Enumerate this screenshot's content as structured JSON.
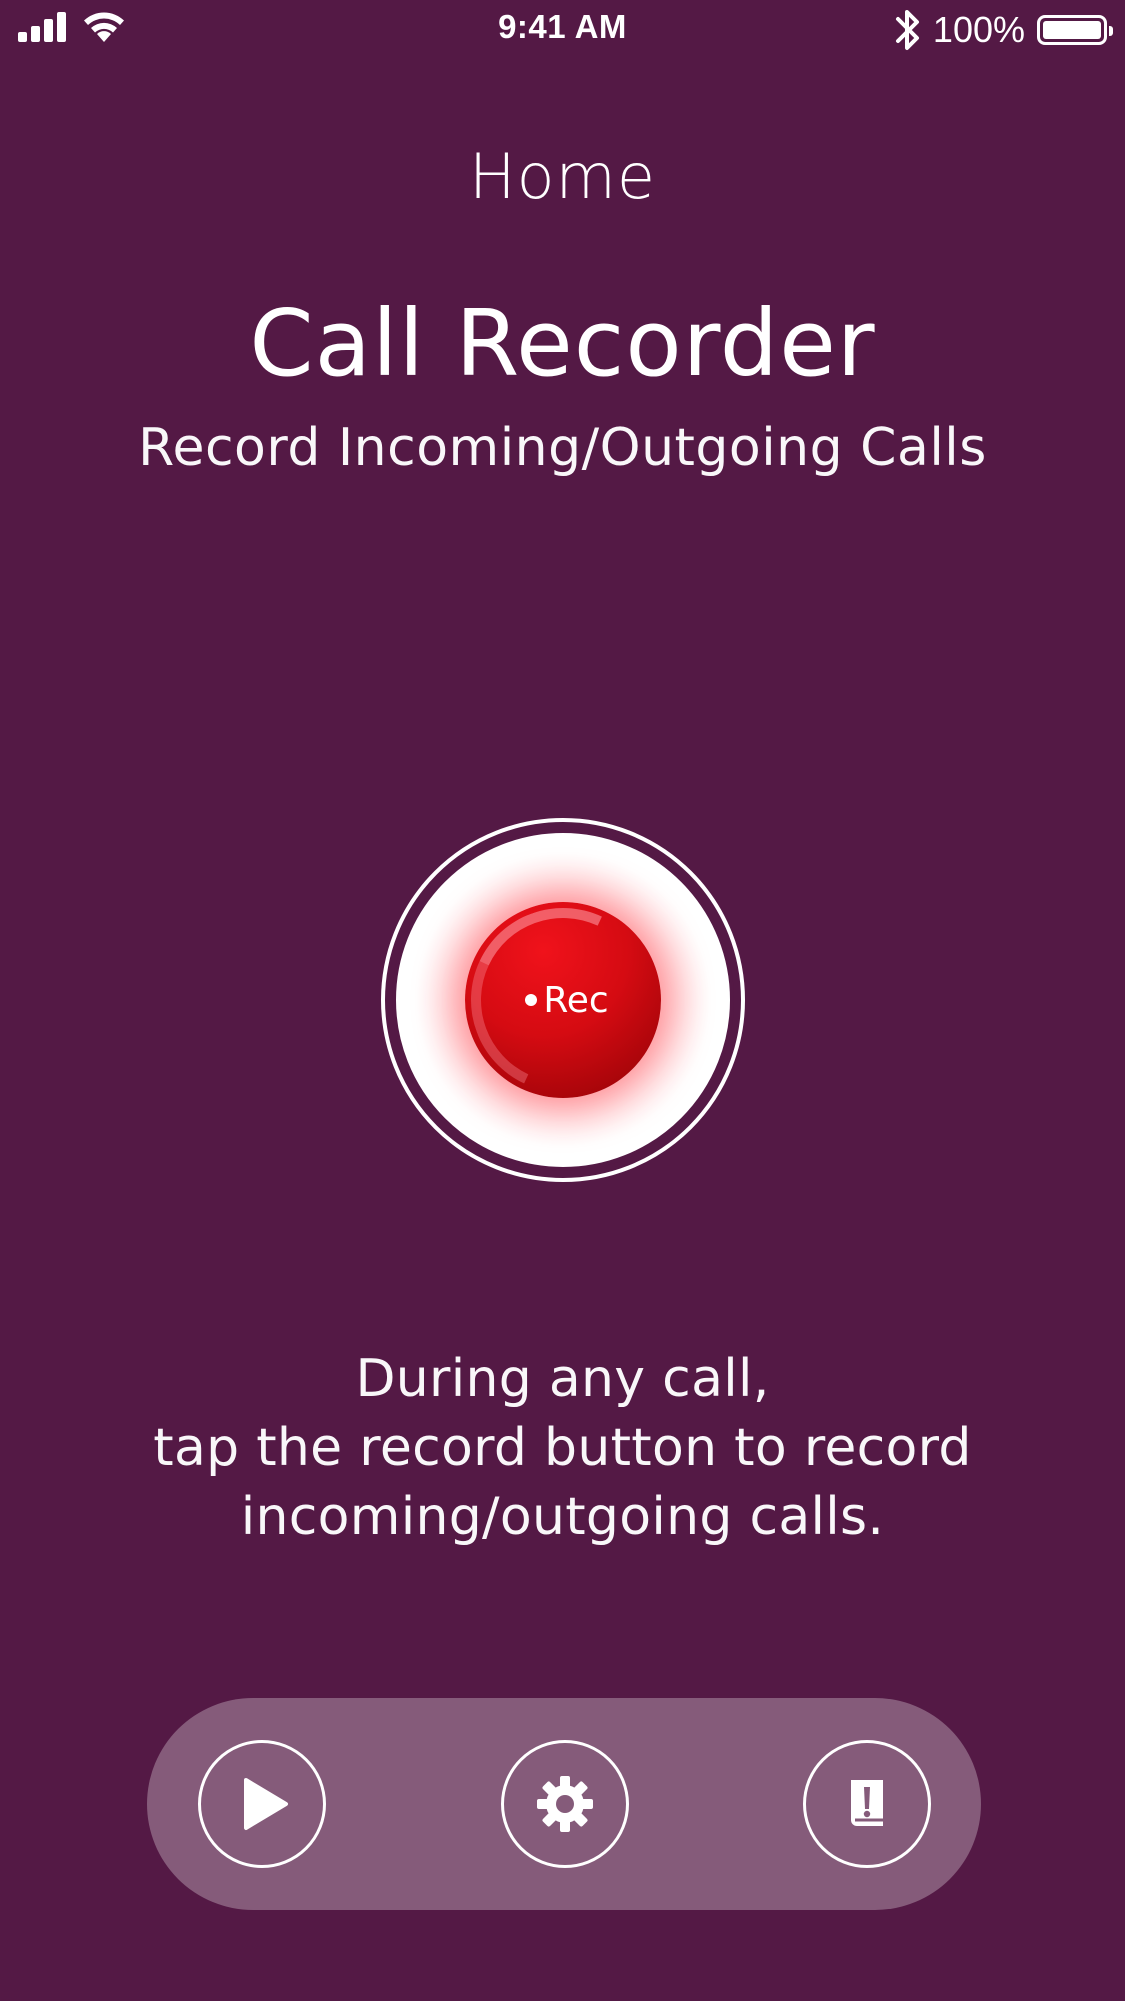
{
  "status_bar": {
    "time": "9:41 AM",
    "battery_percent": "100%",
    "battery_level": 1.0,
    "icons": [
      "signal-bars-icon",
      "wifi-icon",
      "bluetooth-icon",
      "battery-icon"
    ]
  },
  "header": {
    "nav_title": "Home",
    "app_title": "Call Recorder",
    "app_subtitle": "Record Incoming/Outgoing Calls"
  },
  "record_button": {
    "label": "Rec",
    "icon": "record-dot-icon"
  },
  "instructions": {
    "lines": [
      "During any call,",
      "tap the record button to record",
      "incoming/outgoing calls."
    ]
  },
  "toolbar": {
    "buttons": [
      {
        "name": "play-button",
        "icon": "play-icon"
      },
      {
        "name": "settings-button",
        "icon": "gear-icon"
      },
      {
        "name": "notes-button",
        "icon": "notebook-exclamation-icon"
      }
    ]
  },
  "colors": {
    "background": "#541945",
    "toolbar": "#855b7a",
    "record_red": "#d50b12",
    "text": "#ffffff"
  }
}
